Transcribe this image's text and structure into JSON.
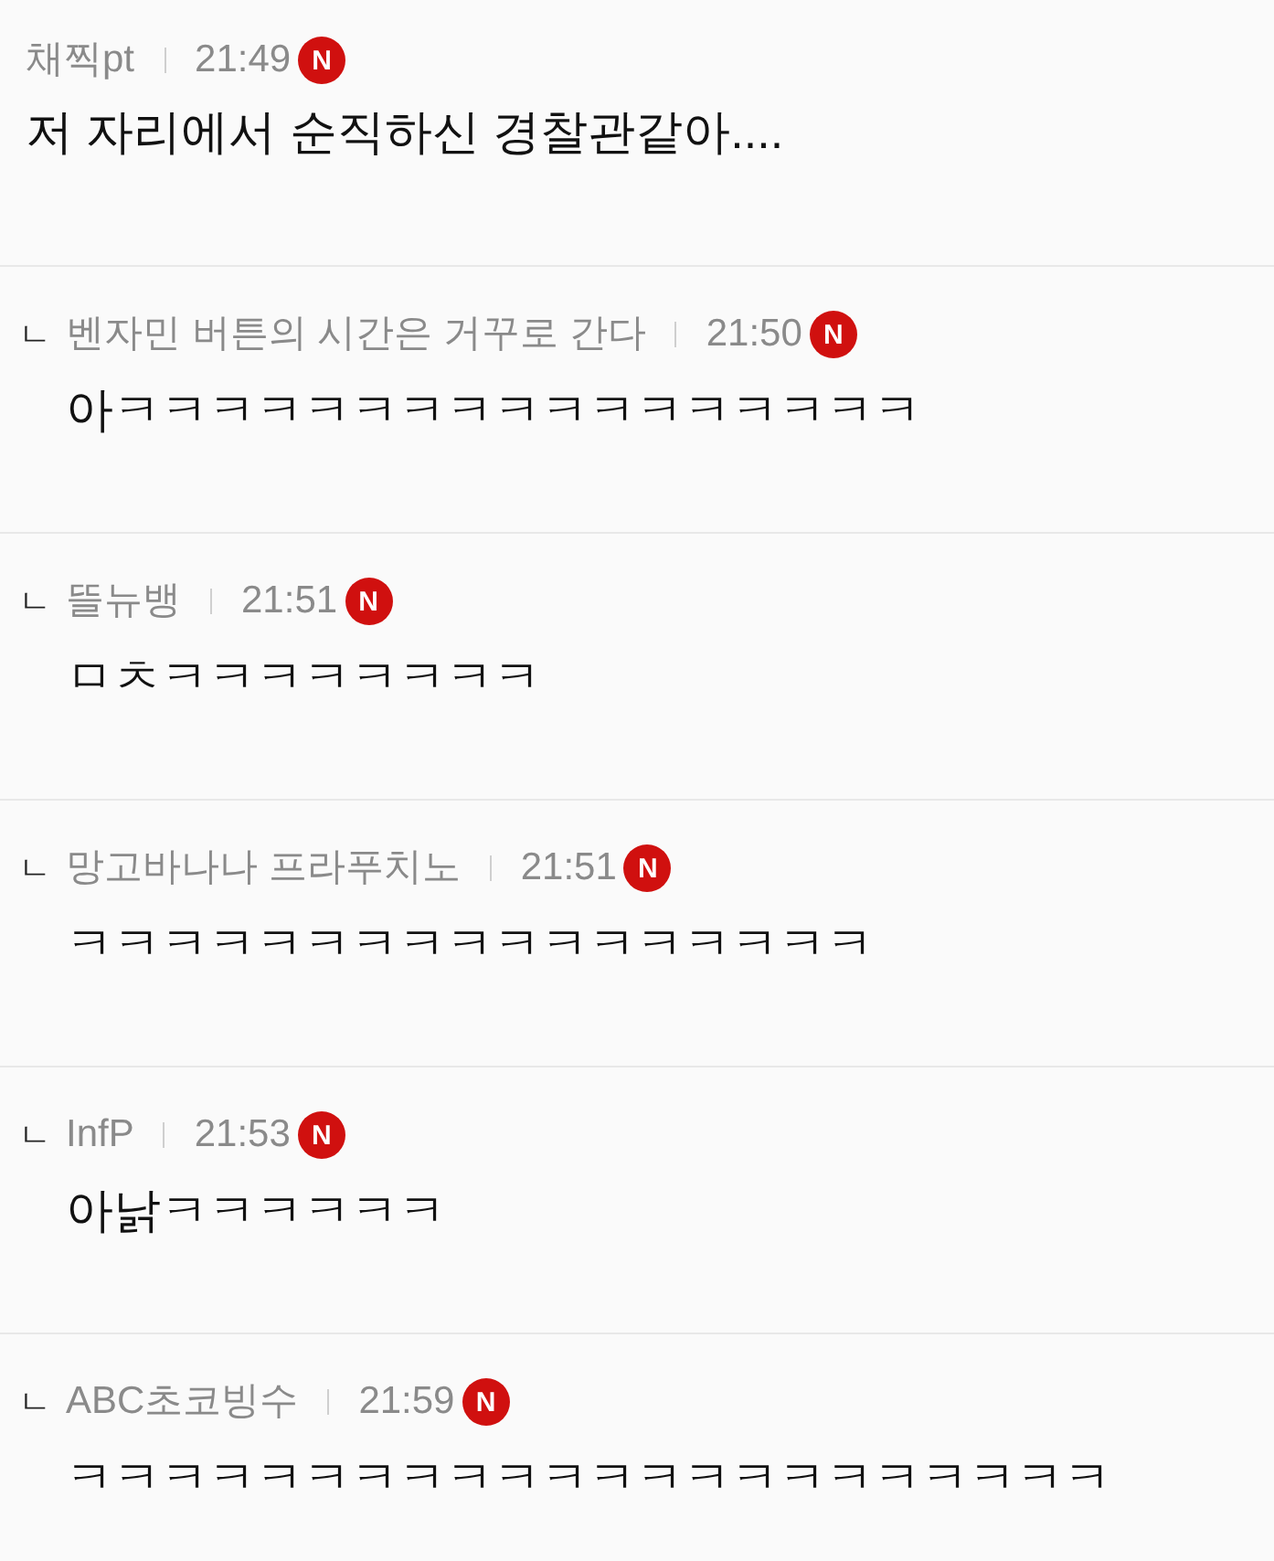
{
  "comments": [
    {
      "author": "채찍pt",
      "time": "21:49",
      "badge": "N",
      "text": "저 자리에서 순직하신 경찰관같아...."
    },
    {
      "marker": "ㄴ",
      "author": "벤자민 버튼의 시간은 거꾸로 간다",
      "time": "21:50",
      "badge": "N",
      "text": "아ㅋㅋㅋㅋㅋㅋㅋㅋㅋㅋㅋㅋㅋㅋㅋㅋㅋ"
    },
    {
      "marker": "ㄴ",
      "author": "뜰뉴뱅",
      "time": "21:51",
      "badge": "N",
      "text": "ㅁㅊㅋㅋㅋㅋㅋㅋㅋㅋ"
    },
    {
      "marker": "ㄴ",
      "author": "망고바나나 프라푸치노",
      "time": "21:51",
      "badge": "N",
      "text": "ㅋㅋㅋㅋㅋㅋㅋㅋㅋㅋㅋㅋㅋㅋㅋㅋㅋ"
    },
    {
      "marker": "ㄴ",
      "author": "InfP",
      "time": "21:53",
      "badge": "N",
      "text": "아낡ㅋㅋㅋㅋㅋㅋ"
    },
    {
      "marker": "ㄴ",
      "author": "ABC초코빙수",
      "time": "21:59",
      "badge": "N",
      "text": "ㅋㅋㅋㅋㅋㅋㅋㅋㅋㅋㅋㅋㅋㅋㅋㅋㅋㅋㅋㅋㅋㅋ"
    }
  ]
}
